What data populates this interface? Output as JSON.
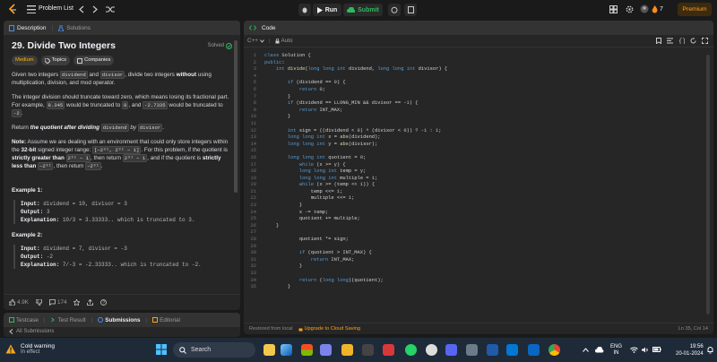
{
  "topbar": {
    "problem_list": "Problem List",
    "run": "Run",
    "submit": "Submit",
    "streak": "7",
    "premium": "Premium"
  },
  "left": {
    "tabs": {
      "description": "Description",
      "solutions": "Solutions"
    },
    "title": "29. Divide Two Integers",
    "solved": "Solved",
    "tags": {
      "difficulty": "Medium",
      "topics": "Topics",
      "companies": "Companies"
    },
    "p1": {
      "a": "Given two integers ",
      "c1": "dividend",
      "b": " and ",
      "c2": "divisor",
      "c": ", divide two integers ",
      "d": "without",
      "e": " using multiplication, division, and mod operator."
    },
    "p2": {
      "a": "The integer division should truncate toward zero, which means losing its fractional part. For example, ",
      "c1": "8.345",
      "b": " would be truncated to ",
      "c2": "8",
      "c": ", and ",
      "c3": "-2.7335",
      "d": " would be truncated to ",
      "c4": "-2",
      "e": "."
    },
    "p3": {
      "a": "Return ",
      "b": "the quotient after dividing",
      "c1": "dividend",
      "c": " by ",
      "c2": "divisor",
      "d": "."
    },
    "note": {
      "label": "Note:",
      "a": " Assume we are dealing with an environment that could only store integers within the ",
      "b": "32-bit",
      "c": " signed integer range: ",
      "range": "[−2³¹, 2³¹ − 1]",
      "d": ". For this problem, if the quotient is ",
      "e": "strictly greater than",
      "c2": "2³¹ − 1",
      "f": ", then return ",
      "c3": "2³¹ − 1",
      "g": ", and if the quotient is ",
      "h": "strictly less than",
      "c4": "−2³¹",
      "i": ", then return ",
      "c5": "−2³¹",
      "j": "."
    },
    "ex1": {
      "title": "Example 1:",
      "input_label": "Input:",
      "input": " dividend = 10, divisor = 3",
      "output_label": "Output:",
      "output": " 3",
      "expl_label": "Explanation:",
      "expl": " 10/3 = 3.33333.. which is truncated to 3."
    },
    "ex2": {
      "title": "Example 2:",
      "input_label": "Input:",
      "input": " dividend = 7, divisor = -3",
      "output_label": "Output:",
      "output": " -2",
      "expl_label": "Explanation:",
      "expl": " 7/-3 = -2.33333.. which is truncated to -2."
    },
    "likes": "4.9K",
    "comments": "174",
    "bottom_tabs": {
      "testcase": "Testcase",
      "test_result": "Test Result",
      "submissions": "Submissions",
      "editorial": "Editorial"
    },
    "all_submissions": "All Submissions"
  },
  "right": {
    "tab": "Code",
    "lang": "C++",
    "auto": "Auto",
    "code_lines": [
      {
        "n": "1",
        "t": "class Solution {"
      },
      {
        "n": "2",
        "t": "public:"
      },
      {
        "n": "3",
        "t": "    int divide(long long int dividend, long long int divisor) {"
      },
      {
        "n": "4",
        "t": ""
      },
      {
        "n": "5",
        "t": "        if (dividend == 0) {"
      },
      {
        "n": "6",
        "t": "            return 0;"
      },
      {
        "n": "7",
        "t": "        }"
      },
      {
        "n": "8",
        "t": "        if (dividend == LLONG_MIN && divisor == -1) {"
      },
      {
        "n": "9",
        "t": "            return INT_MAX;"
      },
      {
        "n": "10",
        "t": "        }"
      },
      {
        "n": "11",
        "t": ""
      },
      {
        "n": "12",
        "t": "        int sign = ((dividend < 0) ^ (divisor < 0)) ? -1 : 1;"
      },
      {
        "n": "13",
        "t": "        long long int x = abs(dividend);"
      },
      {
        "n": "14",
        "t": "        long long int y = abs(divisor);"
      },
      {
        "n": "15",
        "t": ""
      },
      {
        "n": "16",
        "t": "        long long int quotient = 0;"
      },
      {
        "n": "17",
        "t": "            while (x >= y) {"
      },
      {
        "n": "18",
        "t": "            long long int temp = y;"
      },
      {
        "n": "19",
        "t": "            long long int multiple = 1;"
      },
      {
        "n": "20",
        "t": "            while (x >= (temp << 1)) {"
      },
      {
        "n": "21",
        "t": "                temp <<= 1;"
      },
      {
        "n": "22",
        "t": "                multiple <<= 1;"
      },
      {
        "n": "23",
        "t": "            }"
      },
      {
        "n": "24",
        "t": "            x -= temp;"
      },
      {
        "n": "25",
        "t": "            quotient += multiple;"
      },
      {
        "n": "26",
        "t": "    }"
      },
      {
        "n": "27",
        "t": ""
      },
      {
        "n": "28",
        "t": "            quotient *= sign;"
      },
      {
        "n": "29",
        "t": ""
      },
      {
        "n": "30",
        "t": "            if (quotient > INT_MAX) {"
      },
      {
        "n": "31",
        "t": "                return INT_MAX;"
      },
      {
        "n": "32",
        "t": "            }"
      },
      {
        "n": "33",
        "t": ""
      },
      {
        "n": "34",
        "t": "            return (long long)(quotient);"
      },
      {
        "n": "35",
        "t": "        }"
      }
    ],
    "restored": "Restored from local",
    "upgrade": "Upgrade to Cloud Saving",
    "cursor": "Ln 35, Col 14"
  },
  "taskbar": {
    "weather_title": "Cold warning",
    "weather_sub": "In effect",
    "search": "Search",
    "lang1": "ENG",
    "lang2": "IN",
    "time": "19:56",
    "date": "20-01-2024"
  },
  "colors": {
    "accent": "#2cbb5d",
    "premium_bg": "#ffa116",
    "medium": "#ffb800"
  }
}
